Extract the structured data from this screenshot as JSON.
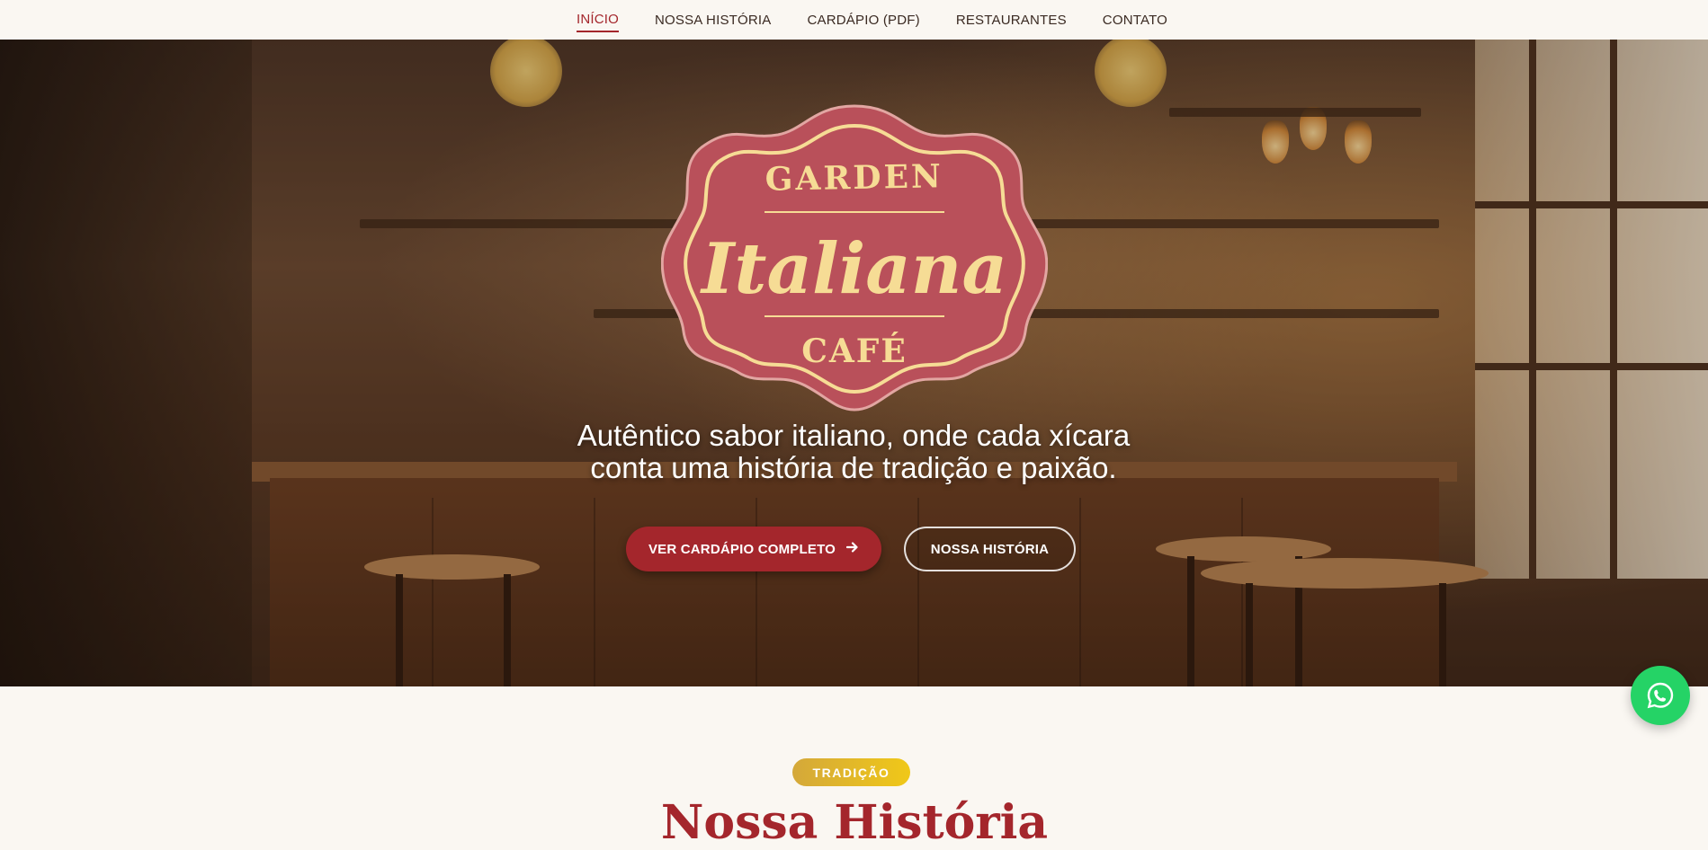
{
  "nav": {
    "items": [
      {
        "label": "INÍCIO",
        "active": true
      },
      {
        "label": "NOSSA HISTÓRIA",
        "active": false
      },
      {
        "label": "CARDÁPIO (PDF)",
        "active": false
      },
      {
        "label": "RESTAURANTES",
        "active": false
      },
      {
        "label": "CONTATO",
        "active": false
      }
    ]
  },
  "logo": {
    "top": "GARDEN",
    "main": "Italiana",
    "bottom": "CAFÉ"
  },
  "hero": {
    "tagline_line1": "Autêntico sabor italiano, onde cada xícara",
    "tagline_line2": "conta uma história de tradição e paixão.",
    "primary_button": "VER CARDÁPIO COMPLETO",
    "primary_button_icon": "arrow-right-icon",
    "secondary_button": "NOSSA HISTÓRIA"
  },
  "whatsapp": {
    "icon": "whatsapp-icon"
  },
  "section": {
    "badge": "TRADIÇÃO",
    "title": "Nossa História"
  },
  "colors": {
    "brand_red": "#a4262c",
    "logo_red": "#b9505a",
    "logo_cream": "#f6dc95",
    "whatsapp_green": "#25d366",
    "badge_gold": "#e2b82a",
    "page_bg": "#faf7f2"
  }
}
